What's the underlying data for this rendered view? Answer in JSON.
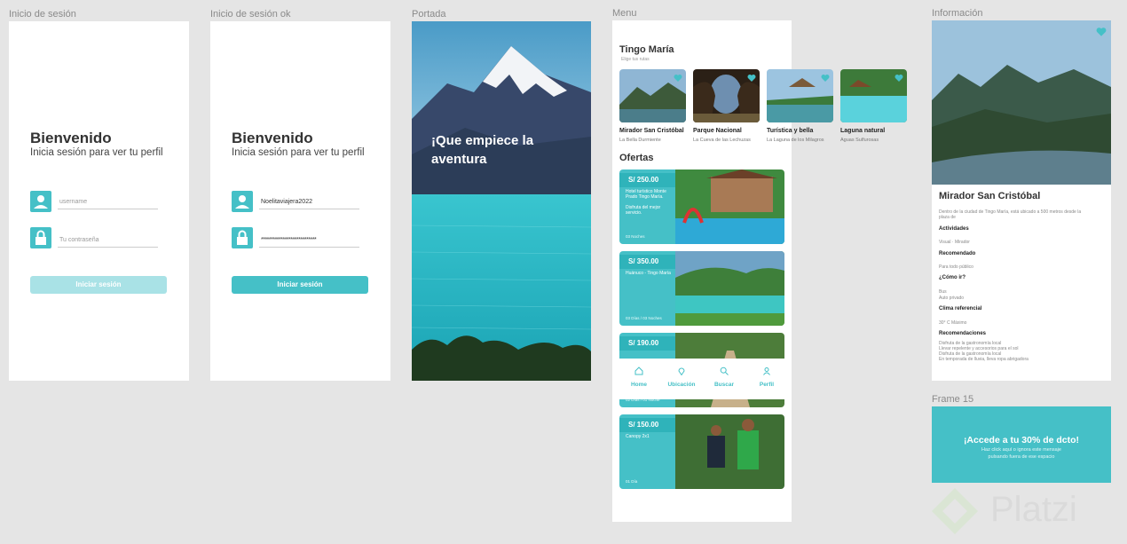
{
  "frame_labels": {
    "login": "Inicio de sesión",
    "login_ok": "Inicio de sesión ok",
    "portada": "Portada",
    "menu": "Menu",
    "info": "Información",
    "frame15": "Frame 15"
  },
  "login": {
    "title": "Bienvenido",
    "subtitle": "Inicia sesión para ver tu perfil",
    "username_placeholder": "username",
    "password_placeholder": "Tu contraseña",
    "button": "Iniciar sesión"
  },
  "login_ok": {
    "title": "Bienvenido",
    "subtitle": "Inicia sesión para ver tu perfil",
    "username_value": "Noelitaviajera2022",
    "password_value": "****************************",
    "button": "Iniciar sesión"
  },
  "portada": {
    "headline": "¡Que empiece la aventura"
  },
  "menu": {
    "title": "Tingo María",
    "subtitle": "Elige tus rutas",
    "places": [
      {
        "title": "Mirador San Cristóbal",
        "sub": "La Bella Durmiente"
      },
      {
        "title": "Parque Nacional",
        "sub": "La Cueva de las Lechuzas"
      },
      {
        "title": "Turística y bella",
        "sub": "La Laguna de los Milagros"
      },
      {
        "title": "Laguna natural",
        "sub": "Aguas Sulfurosas"
      }
    ],
    "offers_title": "Ofertas",
    "offers": [
      {
        "price": "S/ 250.00",
        "desc": "Hotel turístico Monte Prado Tingo María.\n\nDisfruta del mejor servicio.",
        "dur": "03 Noches"
      },
      {
        "price": "S/ 350.00",
        "desc": "Huánuco - Tingo María",
        "dur": "03 Días / 03 Noches"
      },
      {
        "price": "S/ 190.00",
        "desc": "",
        "dur": "02 Días / 01 Noche"
      },
      {
        "price": "S/ 150.00",
        "desc": "Canopy 2x1",
        "dur": "01 Día"
      }
    ],
    "nav": [
      {
        "label": "Home",
        "icon": "home-icon"
      },
      {
        "label": "Ubicación",
        "icon": "location-pin-icon"
      },
      {
        "label": "Buscar",
        "icon": "search-icon"
      },
      {
        "label": "Perfil",
        "icon": "user-icon"
      }
    ]
  },
  "info": {
    "title": "Mirador San Cristóbal",
    "intro": "Dentro de la ciudad de Tingo María, está ubicado a 500 metros desde la",
    "intro2": "plaza de",
    "sections": [
      {
        "heading": "Actividades",
        "text": [
          "Visual · Mirador"
        ]
      },
      {
        "heading": "Recomendado",
        "text": [
          "Para todo público"
        ]
      },
      {
        "heading": "¿Cómo ir?",
        "text": [
          "Bus",
          "Auto privado"
        ]
      },
      {
        "heading": "Clima referencial",
        "text": [
          "30° C Máximo"
        ]
      },
      {
        "heading": "Recomendaciones",
        "text": [
          "Disfruta de la gastronomía local",
          "Llevar repelente y accesorios para el sol",
          "Disfruta de la gastronomía local",
          "En temporada de lluvia, lleva ropa abrigadora"
        ]
      }
    ]
  },
  "frame15": {
    "headline": "¡Accede a tu 30% de dcto!",
    "line1": "Haz click aquí o ignora este mensaje",
    "line2": "pulsando fuera de ese espacio"
  },
  "watermark": "Platzi",
  "colors": {
    "accent": "#45c0c7",
    "accent_dark": "#2fb3ba",
    "canvas": "#e5e5e5"
  }
}
